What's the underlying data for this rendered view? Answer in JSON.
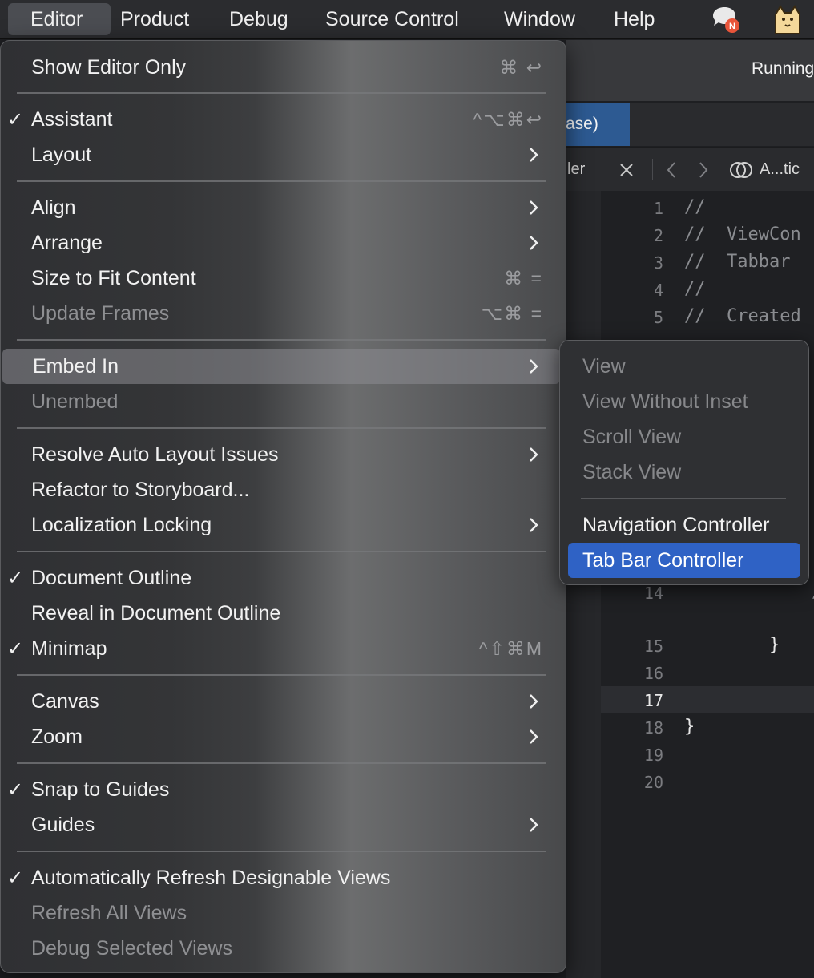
{
  "menubar": {
    "items": [
      {
        "label": "Editor"
      },
      {
        "label": "Product"
      },
      {
        "label": "Debug"
      },
      {
        "label": "Source Control"
      },
      {
        "label": "Window"
      },
      {
        "label": "Help"
      }
    ],
    "icons": [
      "chat-notification-icon",
      "cat-avatar-icon"
    ],
    "notification_badge_color": "#e8553a"
  },
  "toolbar": {
    "status": "Running"
  },
  "tab": {
    "label": "ase)"
  },
  "jumpbar": {
    "file": "ler",
    "related": "A...tic"
  },
  "code": {
    "lines": [
      {
        "n": "1",
        "text": "//"
      },
      {
        "n": "2",
        "text": "//  ViewCon"
      },
      {
        "n": "3",
        "text": "//  Tabbar"
      },
      {
        "n": "4",
        "text": "//"
      },
      {
        "n": "5",
        "text": "//  Created"
      },
      {
        "n": "14",
        "text": "            //"
      },
      {
        "n": "15",
        "text": "        }"
      },
      {
        "n": "16",
        "text": ""
      },
      {
        "n": "17",
        "text": ""
      },
      {
        "n": "18",
        "text": "}"
      },
      {
        "n": "19",
        "text": ""
      },
      {
        "n": "20",
        "text": ""
      }
    ]
  },
  "menu": {
    "items": [
      {
        "label": "Show Editor Only",
        "shortcut": "⌘ ↩"
      },
      {
        "label": "Assistant",
        "shortcut": "^⌥⌘↩",
        "checked": "✓"
      },
      {
        "label": "Layout"
      },
      {
        "label": "Align"
      },
      {
        "label": "Arrange"
      },
      {
        "label": "Size to Fit Content",
        "shortcut": "⌘ ="
      },
      {
        "label": "Update Frames",
        "shortcut": "⌥⌘ ="
      },
      {
        "label": "Embed In"
      },
      {
        "label": "Unembed"
      },
      {
        "label": "Resolve Auto Layout Issues"
      },
      {
        "label": "Refactor to Storyboard..."
      },
      {
        "label": "Localization Locking"
      },
      {
        "label": "Document Outline",
        "checked": "✓"
      },
      {
        "label": "Reveal in Document Outline"
      },
      {
        "label": "Minimap",
        "shortcut": "^⇧⌘M",
        "checked": "✓"
      },
      {
        "label": "Canvas"
      },
      {
        "label": "Zoom"
      },
      {
        "label": "Snap to Guides",
        "checked": "✓"
      },
      {
        "label": "Guides"
      },
      {
        "label": "Automatically Refresh Designable Views",
        "checked": "✓"
      },
      {
        "label": "Refresh All Views"
      },
      {
        "label": "Debug Selected Views"
      }
    ]
  },
  "submenu": {
    "items": [
      {
        "label": "View"
      },
      {
        "label": "View Without Inset"
      },
      {
        "label": "Scroll View"
      },
      {
        "label": "Stack View"
      },
      {
        "label": "Navigation Controller"
      },
      {
        "label": "Tab Bar Controller"
      }
    ],
    "selected_color": "#2f62c5"
  }
}
